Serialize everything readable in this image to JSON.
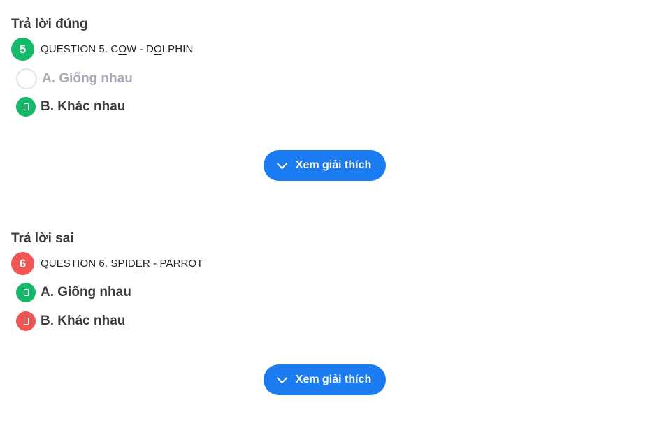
{
  "colors": {
    "correct": "#16b86a",
    "wrong": "#ee5553",
    "button": "#1a7cf0"
  },
  "q5": {
    "status": "Trả lời đúng",
    "number": "5",
    "prefix": "QUESTION 5. C",
    "u1": "O",
    "mid": "W - D",
    "u2": "O",
    "suffix": "LPHIN",
    "option_a": "A. Giống nhau",
    "option_b": "B. Khác nhau",
    "explain": "Xem giải thích"
  },
  "q6": {
    "status": "Trả lời sai",
    "number": "6",
    "prefix": "QUESTION 6. SPID",
    "u1": "E",
    "mid": "R - PARR",
    "u2": "O",
    "suffix": "T",
    "option_a": "A. Giống nhau",
    "option_b": "B. Khác nhau",
    "explain": "Xem giải thích"
  }
}
